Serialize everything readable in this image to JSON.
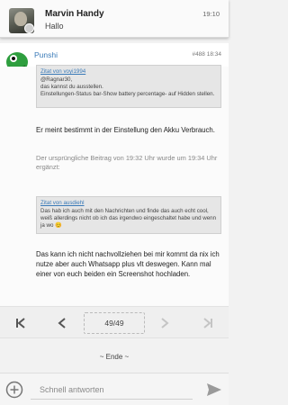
{
  "notification": {
    "sender": "Marvin Handy",
    "message": "Hallo",
    "time": "19:10"
  },
  "post": {
    "username": "Punshi",
    "meta": "#488  18:34",
    "quote1": {
      "header": "Zitat von voyi1994",
      "lines": [
        "@Ragnar30,",
        "das kannst du ausstellen.",
        "Einstellungen-Status bar-Show battery percentage- auf Hidden stellen."
      ]
    },
    "text1": "Er meint bestimmt in der Einstellung den Akku Verbrauch.",
    "edit_note": "Der ursprüngliche Beitrag von 19:32 Uhr wurde um 19:34 Uhr ergänzt:",
    "quote2": {
      "header": "Zitat von ausdiehl",
      "lines": [
        "Das hab ich auch mit den Nachrichten und finde das auch echt cool, weiß allerdings nicht ob ich das irgendwo eingeschaltet habe und wenn ja wo 😊"
      ]
    },
    "text2": "Das kann ich nicht nachvollziehen bei mir kommt da nix ich nutze aber auch Whatsapp plus vlt deswegen. Kann mal einer von euch beiden ein Screenshot hochladen."
  },
  "pagination": {
    "page_indicator": "49/49"
  },
  "end_label": "~ Ende ~",
  "reply": {
    "placeholder": "Schnell antworten"
  },
  "colors": {
    "link": "#3a7ab8",
    "avatar_green": "#2e9e3e"
  },
  "icons": [
    "first-page-icon",
    "prev-page-icon",
    "next-page-icon",
    "last-page-icon",
    "add-icon",
    "send-icon",
    "whatsapp-icon"
  ]
}
